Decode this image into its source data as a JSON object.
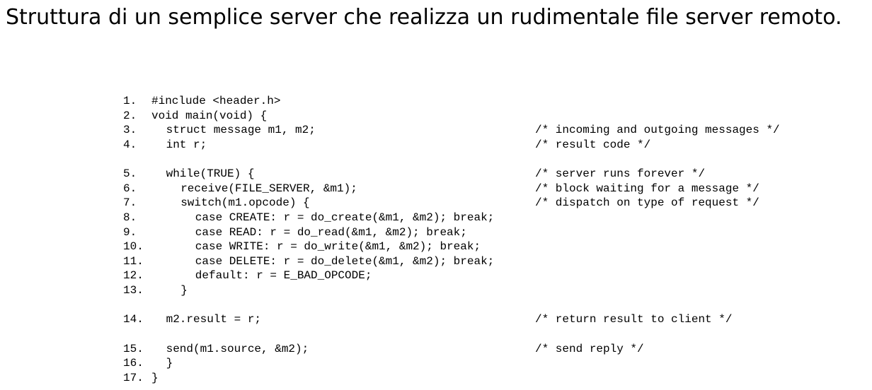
{
  "document": {
    "title": "Struttura di un semplice server che realizza un rudimentale file server remoto."
  },
  "code": {
    "lines": [
      {
        "num": "1.",
        "text": "#include <header.h>",
        "comment": "",
        "indent": 0,
        "gap": false
      },
      {
        "num": "2.",
        "text": "void main(void) {",
        "comment": "",
        "indent": 0,
        "gap": false
      },
      {
        "num": "3.",
        "text": "struct message m1, m2;",
        "comment": "/* incoming and outgoing messages */",
        "indent": 2,
        "gap": false
      },
      {
        "num": "4.",
        "text": "int r;",
        "comment": "/* result code */",
        "indent": 2,
        "gap": false
      },
      {
        "num": "5.",
        "text": "while(TRUE) {",
        "comment": "/* server runs forever */",
        "indent": 2,
        "gap": true
      },
      {
        "num": "6.",
        "text": "receive(FILE_SERVER, &m1);",
        "comment": "/* block waiting for a message */",
        "indent": 4,
        "gap": false
      },
      {
        "num": "7.",
        "text": "switch(m1.opcode) {",
        "comment": "/* dispatch on type of request */",
        "indent": 4,
        "gap": false
      },
      {
        "num": "8.",
        "text": "case CREATE: r = do_create(&m1, &m2); break;",
        "comment": "",
        "indent": 6,
        "gap": false
      },
      {
        "num": "9.",
        "text": "case READ: r = do_read(&m1, &m2); break;",
        "comment": "",
        "indent": 6,
        "gap": false
      },
      {
        "num": "10.",
        "text": "case WRITE: r = do_write(&m1, &m2); break;",
        "comment": "",
        "indent": 6,
        "gap": false
      },
      {
        "num": "11.",
        "text": "case DELETE: r = do_delete(&m1, &m2); break;",
        "comment": "",
        "indent": 6,
        "gap": false
      },
      {
        "num": "12.",
        "text": "default: r = E_BAD_OPCODE;",
        "comment": "",
        "indent": 6,
        "gap": false
      },
      {
        "num": "13.",
        "text": "}",
        "comment": "",
        "indent": 4,
        "gap": false
      },
      {
        "num": "14.",
        "text": "m2.result = r;",
        "comment": "/* return result to client */",
        "indent": 2,
        "gap": true
      },
      {
        "num": "15.",
        "text": "send(m1.source, &m2);",
        "comment": "/* send reply */",
        "indent": 2,
        "gap": true
      },
      {
        "num": "16.",
        "text": "}",
        "comment": "",
        "indent": 2,
        "gap": false
      },
      {
        "num": "17.",
        "text": "}",
        "comment": "",
        "indent": 0,
        "gap": false
      }
    ]
  }
}
